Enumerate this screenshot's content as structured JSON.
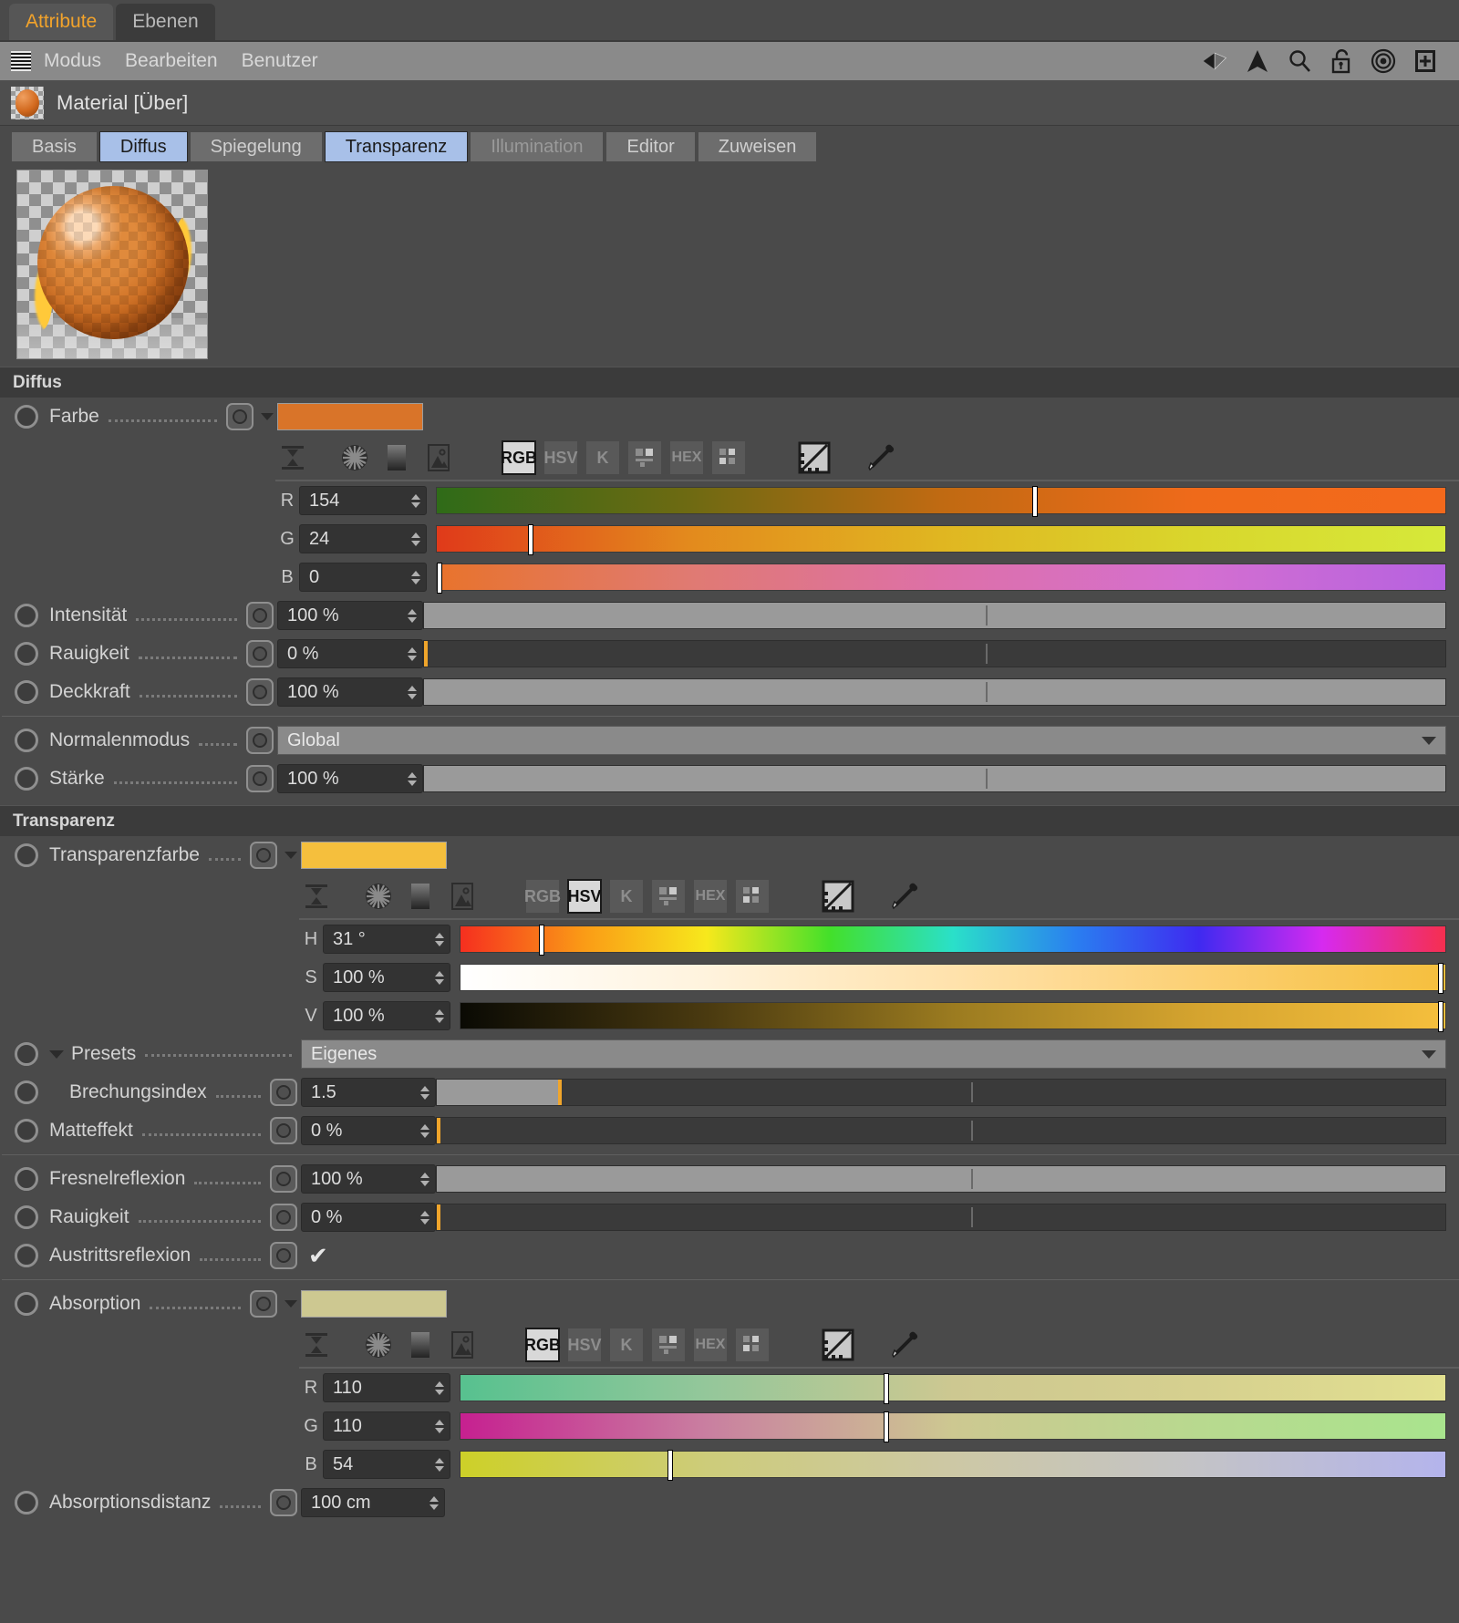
{
  "window": {
    "tabs": [
      {
        "label": "Attribute",
        "active": true
      },
      {
        "label": "Ebenen",
        "active": false
      }
    ]
  },
  "menubar": {
    "grip_icon": "grip-icon",
    "items": [
      "Modus",
      "Bearbeiten",
      "Benutzer"
    ],
    "tools": [
      "back-arrow-icon",
      "up-arrow-icon",
      "search-icon",
      "unlock-icon",
      "target-icon",
      "add-box-icon"
    ]
  },
  "object": {
    "thumb_icon": "material-sphere-icon",
    "title": "Material [Über]"
  },
  "property_tabs": [
    {
      "label": "Basis",
      "state": "normal"
    },
    {
      "label": "Diffus",
      "state": "selected"
    },
    {
      "label": "Spiegelung",
      "state": "normal"
    },
    {
      "label": "Transparenz",
      "state": "selected"
    },
    {
      "label": "Illumination",
      "state": "dim"
    },
    {
      "label": "Editor",
      "state": "normal"
    },
    {
      "label": "Zuweisen",
      "state": "normal"
    }
  ],
  "preview": {
    "name": "material-preview"
  },
  "sections": {
    "diffus": {
      "title": "Diffus",
      "color_row": {
        "label": "Farbe",
        "swatch_hex": "#d97429"
      },
      "color_modes": {
        "icons": [
          "range-icon",
          "color-wheel-icon",
          "gradient-icon",
          "image-icon"
        ],
        "modes": [
          "RGB",
          "HSV",
          "K",
          "mixer-icon",
          "HEX",
          "swatches-icon"
        ],
        "active_mode": "RGB",
        "extra": [
          "split-compare-icon",
          "eyedropper-icon"
        ]
      },
      "channels": [
        {
          "name": "R",
          "value": "154",
          "knob_pct": 59
        },
        {
          "name": "G",
          "value": "24",
          "knob_pct": 9
        },
        {
          "name": "B",
          "value": "0",
          "knob_pct": 0
        }
      ],
      "params": [
        {
          "label": "Intensität",
          "value": "100 %",
          "fill_pct": 100
        },
        {
          "label": "Rauigkeit",
          "value": "0 %",
          "fill_pct": 0
        },
        {
          "label": "Deckkraft",
          "value": "100 %",
          "fill_pct": 100
        }
      ],
      "normal_mode": {
        "label": "Normalenmodus",
        "value": "Global"
      },
      "strength": {
        "label": "Stärke",
        "value": "100 %",
        "fill_pct": 100
      }
    },
    "transparenz": {
      "title": "Transparenz",
      "color_row": {
        "label": "Transparenzfarbe",
        "swatch_hex": "#f5bf3d"
      },
      "color_modes": {
        "icons": [
          "range-icon",
          "color-wheel-icon",
          "gradient-icon",
          "image-icon"
        ],
        "modes": [
          "RGB",
          "HSV",
          "K",
          "mixer-icon",
          "HEX",
          "swatches-icon"
        ],
        "active_mode": "HSV",
        "extra": [
          "split-compare-icon",
          "eyedropper-icon"
        ]
      },
      "channels": [
        {
          "name": "H",
          "value": "31 °",
          "knob_pct": 8
        },
        {
          "name": "S",
          "value": "100 %",
          "knob_pct": 100
        },
        {
          "name": "V",
          "value": "100 %",
          "knob_pct": 100
        }
      ],
      "presets": {
        "label": "Presets",
        "value": "Eigenes"
      },
      "refraction": {
        "label": "Brechungsindex",
        "value": "1.5",
        "fill_pct": 12
      },
      "matte": {
        "label": "Matteffekt",
        "value": "0 %",
        "fill_pct": 0
      },
      "fresnel": {
        "label": "Fresnelreflexion",
        "value": "100 %",
        "fill_pct": 100
      },
      "roughness": {
        "label": "Rauigkeit",
        "value": "0 %",
        "fill_pct": 0
      },
      "exit_reflection": {
        "label": "Austrittsreflexion",
        "checked": true
      },
      "absorption": {
        "label": "Absorption",
        "swatch_hex": "#cdc891",
        "color_modes": {
          "icons": [
            "range-icon",
            "color-wheel-icon",
            "gradient-icon",
            "image-icon"
          ],
          "modes": [
            "RGB",
            "HSV",
            "K",
            "mixer-icon",
            "HEX",
            "swatches-icon"
          ],
          "active_mode": "RGB",
          "extra": [
            "split-compare-icon",
            "eyedropper-icon"
          ]
        },
        "channels": [
          {
            "name": "R",
            "value": "110",
            "knob_pct": 43
          },
          {
            "name": "G",
            "value": "110",
            "knob_pct": 43
          },
          {
            "name": "B",
            "value": "54",
            "knob_pct": 21
          }
        ]
      },
      "absorption_distance": {
        "label": "Absorptionsdistanz",
        "value": "100 cm"
      }
    }
  },
  "colors": {
    "accent_orange": "#f2a32b",
    "tab_selected_blue": "#a8c0e8",
    "panel_bg": "#4a4a4a",
    "field_bg": "#333333"
  }
}
